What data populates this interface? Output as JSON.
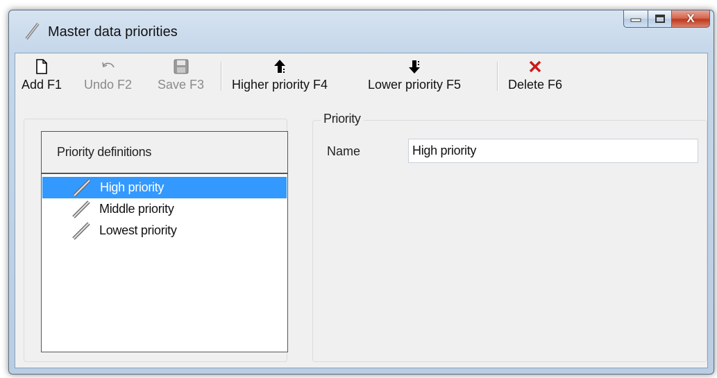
{
  "window": {
    "title": "Master data priorities",
    "close_glyph": "X"
  },
  "toolbar": {
    "add": {
      "label": "Add F1",
      "icon": "new-page-icon",
      "enabled": true
    },
    "undo": {
      "label": "Undo F2",
      "icon": "undo-icon",
      "enabled": false
    },
    "save": {
      "label": "Save F3",
      "icon": "floppy-disk-icon",
      "enabled": false
    },
    "higher": {
      "label": "Higher priority F4",
      "icon": "arrow-up-icon",
      "enabled": true
    },
    "lower": {
      "label": "Lower priority F5",
      "icon": "arrow-down-icon",
      "enabled": true
    },
    "delete": {
      "label": "Delete F6",
      "icon": "red-x-icon",
      "enabled": true
    }
  },
  "list": {
    "header": "Priority definitions",
    "items": [
      {
        "label": "High priority",
        "selected": true
      },
      {
        "label": "Middle priority",
        "selected": false
      },
      {
        "label": "Lowest priority",
        "selected": false
      }
    ]
  },
  "detail": {
    "group_title": "Priority",
    "name_label": "Name",
    "name_value": "High priority"
  },
  "colors": {
    "selection": "#3399ff",
    "delete_red": "#cc1a1a"
  }
}
